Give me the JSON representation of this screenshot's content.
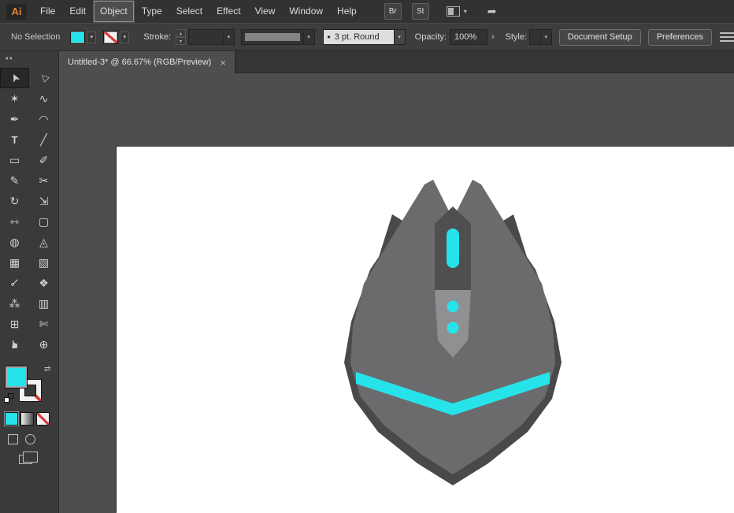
{
  "app": {
    "logo_text": "Ai"
  },
  "icons": {
    "caret": "▾",
    "caret_up": "▴",
    "chevron_right": "›",
    "dot": "•",
    "close": "×",
    "collapse": "◂◂",
    "swap": "⇄"
  },
  "menubar": {
    "items": [
      "File",
      "Edit",
      "Object",
      "Type",
      "Select",
      "Effect",
      "View",
      "Window",
      "Help"
    ],
    "active_item": "Object",
    "panel_buttons": [
      "Br",
      "St"
    ],
    "share_glyph": "➦"
  },
  "controlbar": {
    "selection_status": "No Selection",
    "stroke_label": "Stroke:",
    "brush_definition": "3 pt. Round",
    "opacity_label": "Opacity:",
    "opacity_value": "100%",
    "style_label": "Style:",
    "document_setup_label": "Document Setup",
    "preferences_label": "Preferences"
  },
  "document_tab": {
    "title": "Untitled-3* @ 66.67% (RGB/Preview)"
  },
  "tools": [
    {
      "name": "selection-tool",
      "glyph": "➤",
      "selected": true
    },
    {
      "name": "direct-selection-tool",
      "glyph": "▷"
    },
    {
      "name": "magic-wand-tool",
      "glyph": "✶"
    },
    {
      "name": "lasso-tool",
      "glyph": "∿"
    },
    {
      "name": "pen-tool",
      "glyph": "✒"
    },
    {
      "name": "curvature-tool",
      "glyph": "◠"
    },
    {
      "name": "type-tool",
      "glyph": "T"
    },
    {
      "name": "line-segment-tool",
      "glyph": "╱"
    },
    {
      "name": "rectangle-tool",
      "glyph": "▭"
    },
    {
      "name": "paintbrush-tool",
      "glyph": "✐"
    },
    {
      "name": "pencil-tool",
      "glyph": "✎"
    },
    {
      "name": "scissors-tool",
      "glyph": "✂"
    },
    {
      "name": "rotate-tool",
      "glyph": "↻"
    },
    {
      "name": "scale-tool",
      "glyph": "⇲"
    },
    {
      "name": "width-tool",
      "glyph": "⇿"
    },
    {
      "name": "free-transform-tool",
      "glyph": "▢"
    },
    {
      "name": "shape-builder-tool",
      "glyph": "◍"
    },
    {
      "name": "perspective-grid-tool",
      "glyph": "◬"
    },
    {
      "name": "mesh-tool",
      "glyph": "▦"
    },
    {
      "name": "gradient-tool",
      "glyph": "▧"
    },
    {
      "name": "eyedropper-tool",
      "glyph": "⊸"
    },
    {
      "name": "blend-tool",
      "glyph": "❖"
    },
    {
      "name": "symbol-sprayer-tool",
      "glyph": "⁂"
    },
    {
      "name": "column-graph-tool",
      "glyph": "▥"
    },
    {
      "name": "artboard-tool",
      "glyph": "⊞"
    },
    {
      "name": "slice-tool",
      "glyph": "✄"
    },
    {
      "name": "hand-tool",
      "glyph": "☛"
    },
    {
      "name": "zoom-tool",
      "glyph": "⊕"
    }
  ],
  "colors": {
    "accent_cyan": "#26e3e9",
    "none_red": "#d93a3a",
    "menubar_bg": "#323232",
    "panel_bg": "#3a3a3a",
    "canvas_bg": "#4e4e50",
    "artboard_white": "#ffffff",
    "logo_orange": "#e8872f"
  },
  "artwork": {
    "subject": "gaming mouse illustration",
    "colors": {
      "body": "#6b6b6d",
      "shadow": "#49494c",
      "well": "#4f4f52",
      "panel": "#909092",
      "accent": "#26e3e9"
    }
  }
}
